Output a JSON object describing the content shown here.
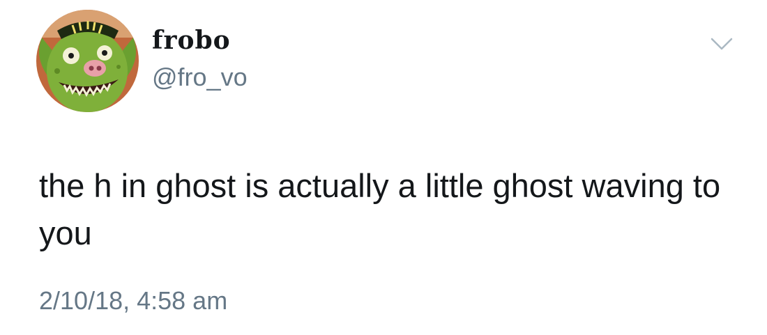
{
  "author": {
    "display_name": "frobo",
    "handle": "@fro_vo",
    "avatar_icon": "green-goblin-avatar-icon"
  },
  "tweet": {
    "text": "the h in ghost is actually a little ghost waving to you",
    "timestamp": "2/10/18, 4:58 am"
  },
  "controls": {
    "menu_icon": "chevron-down-icon"
  },
  "colors": {
    "text_primary": "#14171a",
    "text_secondary": "#657786",
    "chevron": "#aab8c2",
    "avatar_bg": "#c0683c",
    "goblin_skin": "#7fb03a"
  }
}
